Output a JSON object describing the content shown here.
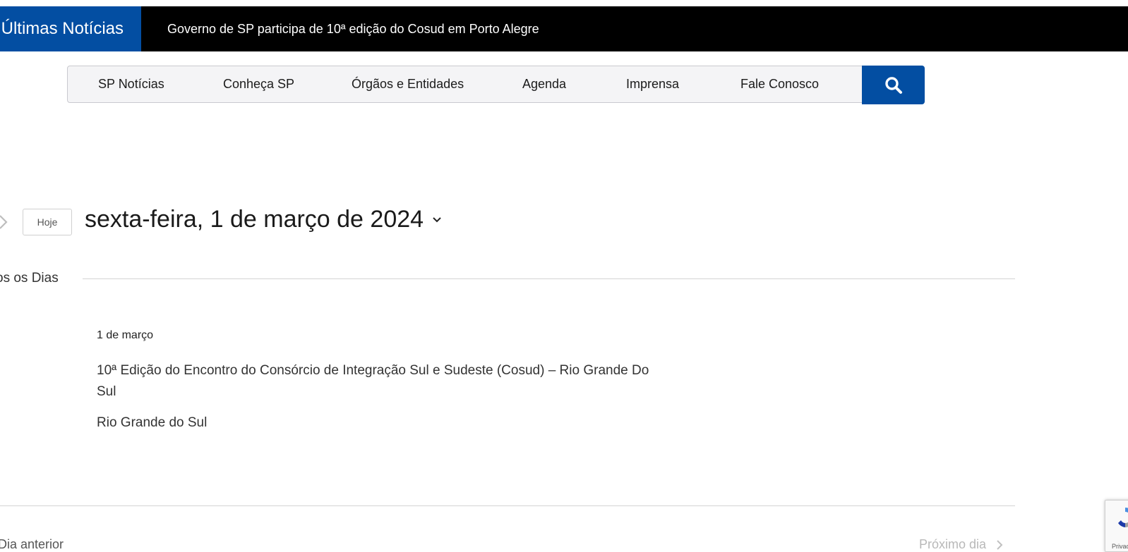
{
  "ticker": {
    "label": "Últimas Notícias",
    "headline": "Governo de SP participa de 10ª edição do Cosud em Porto Alegre"
  },
  "nav": {
    "items": [
      {
        "label": "SP Notícias"
      },
      {
        "label": "Conheça SP"
      },
      {
        "label": "Órgãos e Entidades"
      },
      {
        "label": "Agenda"
      },
      {
        "label": "Imprensa"
      },
      {
        "label": "Fale Conosco"
      }
    ],
    "search_icon": "search-icon"
  },
  "day_nav": {
    "today_label": "Hoje",
    "date_title": "sexta-feira, 1 de março de 2024"
  },
  "group": {
    "heading": "os os Dias"
  },
  "event": {
    "date": "1 de março",
    "title": "10ª Edição do Encontro do Consórcio de Integração Sul e Sudeste (Cosud) – Rio Grande Do Sul",
    "location": "Rio Grande do Sul"
  },
  "footer_nav": {
    "prev_label": "Dia anterior",
    "next_label": "Próximo dia"
  },
  "recaptcha": {
    "text": "Privac"
  },
  "colors": {
    "brand_blue": "#034ea2",
    "ticker_bg": "#000000",
    "nav_bg": "#f4f4f6"
  }
}
